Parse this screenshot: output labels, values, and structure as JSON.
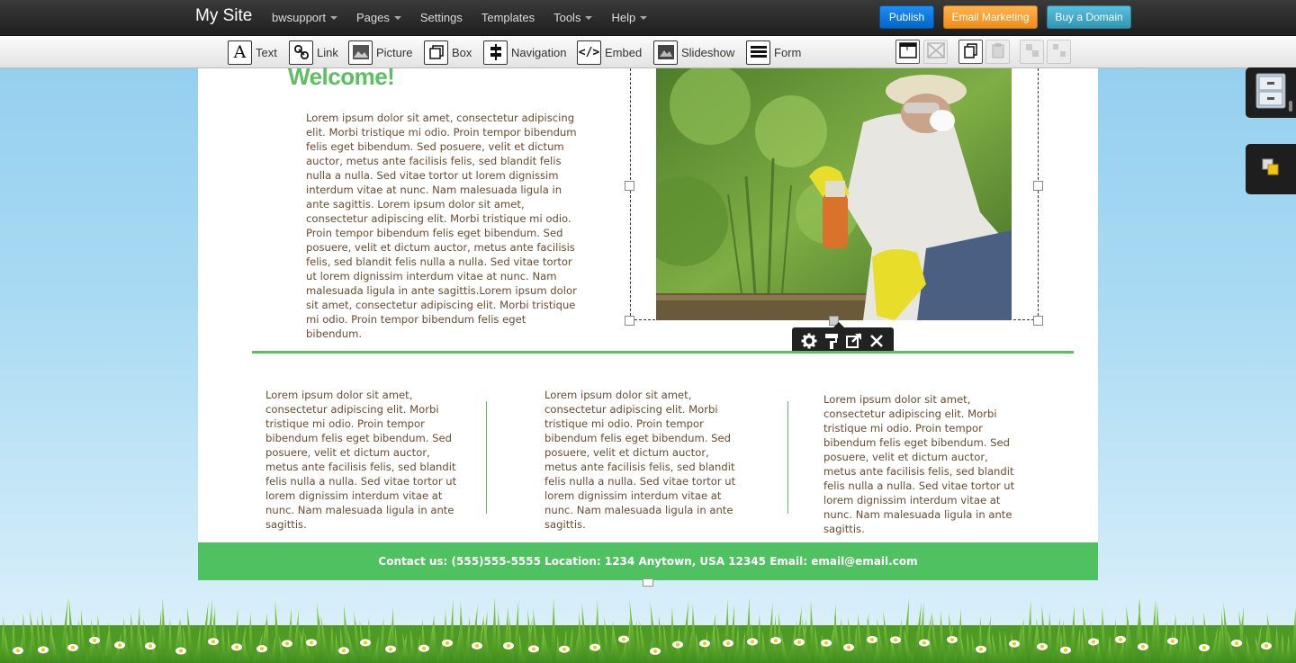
{
  "topbar": {
    "brand": "My Site",
    "nav": [
      {
        "label": "bwsupport",
        "dropdown": true
      },
      {
        "label": "Pages",
        "dropdown": true
      },
      {
        "label": "Settings",
        "dropdown": false
      },
      {
        "label": "Templates",
        "dropdown": false
      },
      {
        "label": "Tools",
        "dropdown": true
      },
      {
        "label": "Help",
        "dropdown": true
      }
    ],
    "publish": "Publish",
    "email_marketing": "Email Marketing",
    "buy_domain": "Buy a Domain",
    "colors": {
      "publish": "#0073de",
      "email": "#f5a031",
      "domain": "#45abc9"
    }
  },
  "toolbar": {
    "tools": [
      {
        "label": "Text",
        "icon": "text-icon"
      },
      {
        "label": "Link",
        "icon": "link-icon"
      },
      {
        "label": "Picture",
        "icon": "picture-icon"
      },
      {
        "label": "Box",
        "icon": "box-icon"
      },
      {
        "label": "Navigation",
        "icon": "navigation-icon"
      },
      {
        "label": "Embed",
        "icon": "embed-icon"
      },
      {
        "label": "Slideshow",
        "icon": "slideshow-icon"
      },
      {
        "label": "Form",
        "icon": "form-icon"
      }
    ],
    "right_tools": [
      {
        "icon": "ruler-icon",
        "enabled": true
      },
      {
        "icon": "clear-icon",
        "enabled": false
      },
      {
        "icon": "copy-icon",
        "enabled": true
      },
      {
        "icon": "paste-icon",
        "enabled": false
      },
      {
        "icon": "group-icon",
        "enabled": false
      },
      {
        "icon": "ungroup-icon",
        "enabled": false
      }
    ]
  },
  "page": {
    "welcome": "Welcome!",
    "main_text": "Lorem ipsum dolor sit amet, consectetur adipiscing elit. Morbi tristique mi odio. Proin tempor bibendum felis eget bibendum. Sed posuere, velit et dictum auctor, metus ante facilisis felis, sed blandit felis nulla a nulla. Sed vitae tortor ut lorem dignissim interdum vitae at nunc. Nam malesuada ligula in ante sagittis. Lorem ipsum dolor sit amet, consectetur adipiscing elit. Morbi tristique mi odio. Proin tempor bibendum felis eget bibendum. Sed posuere, velit et dictum auctor, metus ante facilisis felis, sed blandit felis nulla a nulla. Sed vitae tortor ut lorem dignissim interdum vitae at nunc. Nam malesuada ligula in ante sagittis.Lorem ipsum dolor sit amet, consectetur adipiscing elit. Morbi tristique mi odio. Proin tempor bibendum felis eget bibendum.",
    "columns": [
      "Lorem ipsum dolor sit amet, consectetur adipiscing elit. Morbi tristique mi odio. Proin tempor bibendum felis eget bibendum. Sed posuere, velit et dictum auctor, metus ante facilisis felis, sed blandit felis nulla a nulla. Sed vitae tortor ut lorem dignissim interdum vitae at nunc. Nam malesuada ligula in ante sagittis.",
      "Lorem ipsum dolor sit amet, consectetur adipiscing elit. Morbi tristique mi odio. Proin tempor bibendum felis eget bibendum. Sed posuere, velit et dictum auctor, metus ante facilisis felis, sed blandit felis nulla a nulla. Sed vitae tortor ut lorem dignissim interdum vitae at nunc. Nam malesuada ligula in ante sagittis.",
      "Lorem ipsum dolor sit amet, consectetur adipiscing elit. Morbi tristique mi odio. Proin tempor bibendum felis eget bibendum. Sed posuere, velit et dictum auctor, metus ante facilisis felis, sed blandit felis nulla a nulla. Sed vitae tortor ut lorem dignissim interdum vitae at nunc. Nam malesuada ligula in ante sagittis."
    ],
    "footer": "Contact us: (555)555-5555 Location: 1234 Anytown, USA 12345 Email: email@email.com",
    "accent_color": "#5cbf63",
    "text_color": "#6b4b2e",
    "image_toolbar": [
      "settings-icon",
      "paint-format-icon",
      "external-link-icon",
      "close-icon"
    ]
  },
  "sidepanels": [
    "file-cabinet-icon",
    "layers-icon"
  ]
}
